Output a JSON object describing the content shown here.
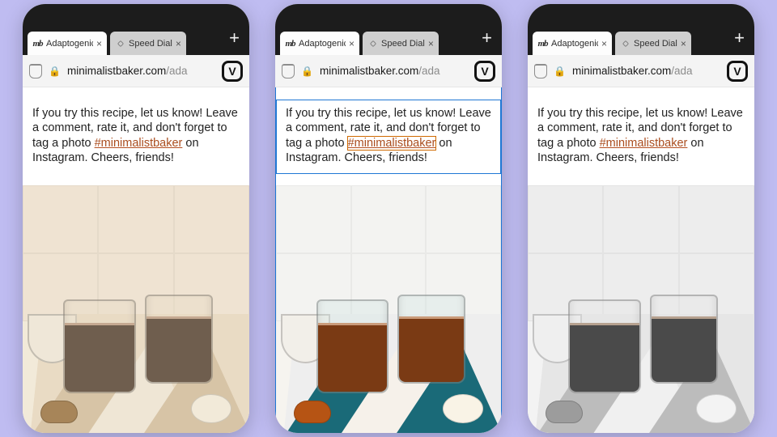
{
  "tabs": {
    "active": {
      "label": "Adaptogenic",
      "favicon_name": "mb-favicon"
    },
    "inactive": {
      "label": "Speed Dial",
      "favicon_name": "vivaldi-favicon"
    },
    "close_glyph": "×",
    "newtab_glyph": "+"
  },
  "address": {
    "lock_glyph": "🔒",
    "domain": "minimalistbaker.com",
    "path": "/ada",
    "vivaldi_glyph": "V"
  },
  "paragraph": {
    "pre": "If you try this recipe, let us know! Leave a comment, rate it, and don't forget to tag a photo ",
    "link": "#minimalistbaker",
    "post": " on Instagram. Cheers, friends!"
  },
  "variants": [
    {
      "theme": "sepia",
      "debug": false
    },
    {
      "theme": "color",
      "debug": true
    },
    {
      "theme": "mono",
      "debug": false
    }
  ],
  "colors": {
    "background": "#bfbcf1",
    "link": "#aa4d1f"
  }
}
